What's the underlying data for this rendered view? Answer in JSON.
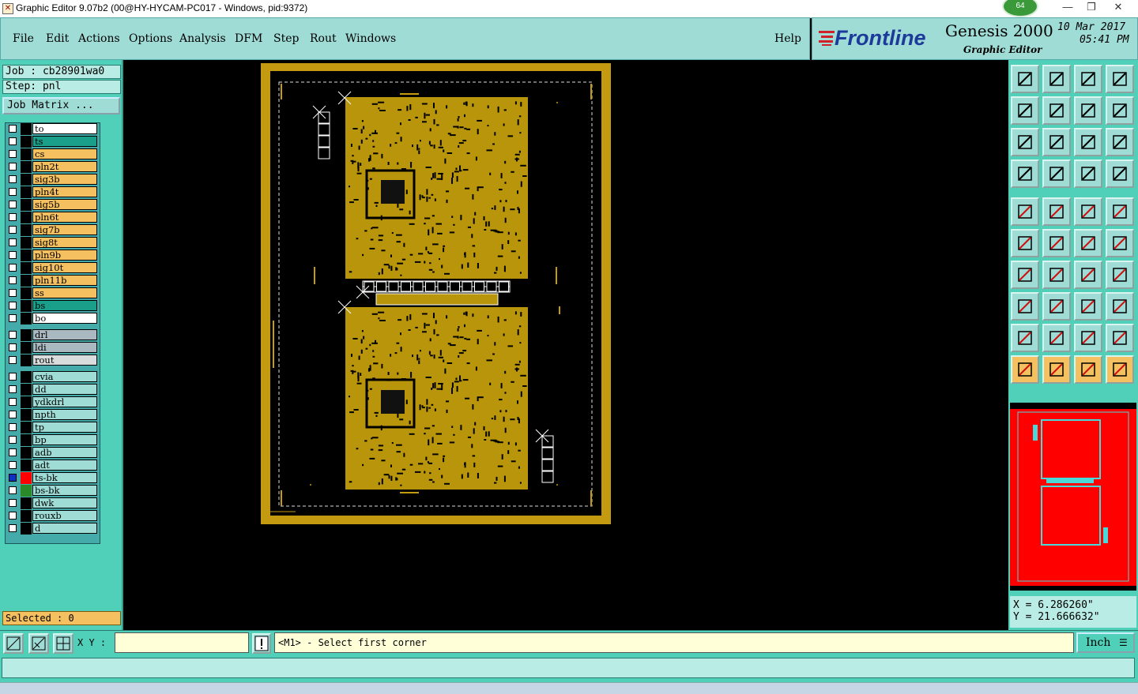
{
  "window": {
    "title": "Graphic Editor 9.07b2 (00@HY-HYCAM-PC017 - Windows, pid:9372)",
    "badge": "64"
  },
  "menu": {
    "items": [
      "File",
      "Edit",
      "Actions",
      "Options",
      "Analysis",
      "DFM",
      "Step",
      "Rout",
      "Windows"
    ],
    "help": "Help"
  },
  "brand": {
    "logo": "Frontline",
    "product": "Genesis 2000",
    "subtitle": "Graphic Editor",
    "date": "10 Mar 2017",
    "time": "05:41 PM"
  },
  "job": {
    "job_label": "Job : cb28901wa0",
    "step_label": "Step: pnl",
    "matrix_button": "Job Matrix ..."
  },
  "layers": [
    {
      "name": "to",
      "color": "#ffffff"
    },
    {
      "name": "ts",
      "color": "#1aa08a"
    },
    {
      "name": "cs",
      "color": "#f5c060"
    },
    {
      "name": "pln2t",
      "color": "#f5c060"
    },
    {
      "name": "sig3b",
      "color": "#f5c060"
    },
    {
      "name": "pln4t",
      "color": "#f5c060"
    },
    {
      "name": "sig5b",
      "color": "#f5c060"
    },
    {
      "name": "pln6t",
      "color": "#f5c060"
    },
    {
      "name": "sig7b",
      "color": "#f5c060"
    },
    {
      "name": "sig8t",
      "color": "#f5c060"
    },
    {
      "name": "pln9b",
      "color": "#f5c060"
    },
    {
      "name": "sig10t",
      "color": "#f5c060"
    },
    {
      "name": "pln11b",
      "color": "#f5c060"
    },
    {
      "name": "ss",
      "color": "#f5c060"
    },
    {
      "name": "bs",
      "color": "#1aa08a"
    },
    {
      "name": "bo",
      "color": "#ffffff"
    },
    {
      "name": "drl",
      "color": "#aab8c0"
    },
    {
      "name": "ldi",
      "color": "#aab8c0"
    },
    {
      "name": "rout",
      "color": "#d8dcdc"
    },
    {
      "name": "cvia",
      "color": "#9fdcd6"
    },
    {
      "name": "dd",
      "color": "#9fdcd6"
    },
    {
      "name": "ydkdrl",
      "color": "#9fdcd6"
    },
    {
      "name": "npth",
      "color": "#9fdcd6"
    },
    {
      "name": "tp",
      "color": "#9fdcd6"
    },
    {
      "name": "bp",
      "color": "#9fdcd6"
    },
    {
      "name": "adb",
      "color": "#9fdcd6"
    },
    {
      "name": "adt",
      "color": "#9fdcd6"
    },
    {
      "name": "ts-bk",
      "color": "#9fdcd6",
      "swatch": "#ff0000",
      "active": true
    },
    {
      "name": "bs-bk",
      "color": "#9fdcd6",
      "swatch": "#2a8a2a"
    },
    {
      "name": "dwk",
      "color": "#9fdcd6"
    },
    {
      "name": "rouxb",
      "color": "#9fdcd6"
    },
    {
      "name": "d",
      "color": "#9fdcd6"
    }
  ],
  "selected": "Selected : 0",
  "coords": {
    "x": "X = 6.286260\"",
    "y": "Y = 21.666632\""
  },
  "bottom": {
    "xy_label": "X Y :",
    "message": "<M1> - Select first corner",
    "unit": "Inch"
  },
  "colors": {
    "board": "#b8950a",
    "panel_frame": "#c49a10",
    "accent": "#50d0b8",
    "minimap_bg": "#ff0000"
  },
  "toolbar_icons": [
    "zoom-home-icon",
    "zoom-back-icon",
    "home-view-icon",
    "split-view-icon",
    "pan-left-icon",
    "pan-right-icon",
    "swap-view-icon",
    "redraw-icon",
    "fit-screen-icon",
    "fit-selection-icon",
    "scale-1-2-icon",
    "help-query-icon",
    "snap-settings-icon",
    "grid-icon",
    "layer-stack-icon",
    "layer-stack-alt-icon",
    "fill-mode-icon",
    "outline-mode-icon",
    "measure-icon",
    "pad-icon",
    "connect-icon",
    "cross-icon",
    "line-point-icon",
    "line-point-alt-icon",
    "angle-icon",
    "diagonal-icon",
    "rotate-icon",
    "mirror-icon",
    "feature-select-icon",
    "line-icon",
    "width-icon",
    "group-icon",
    "triangle-icon",
    "triangle-arrow-icon",
    "arc-a-icon",
    "arc-a-alt-icon",
    "pointer-icon",
    "pointer-box-icon",
    "pointer-circle-icon",
    "pointer-path-icon"
  ]
}
